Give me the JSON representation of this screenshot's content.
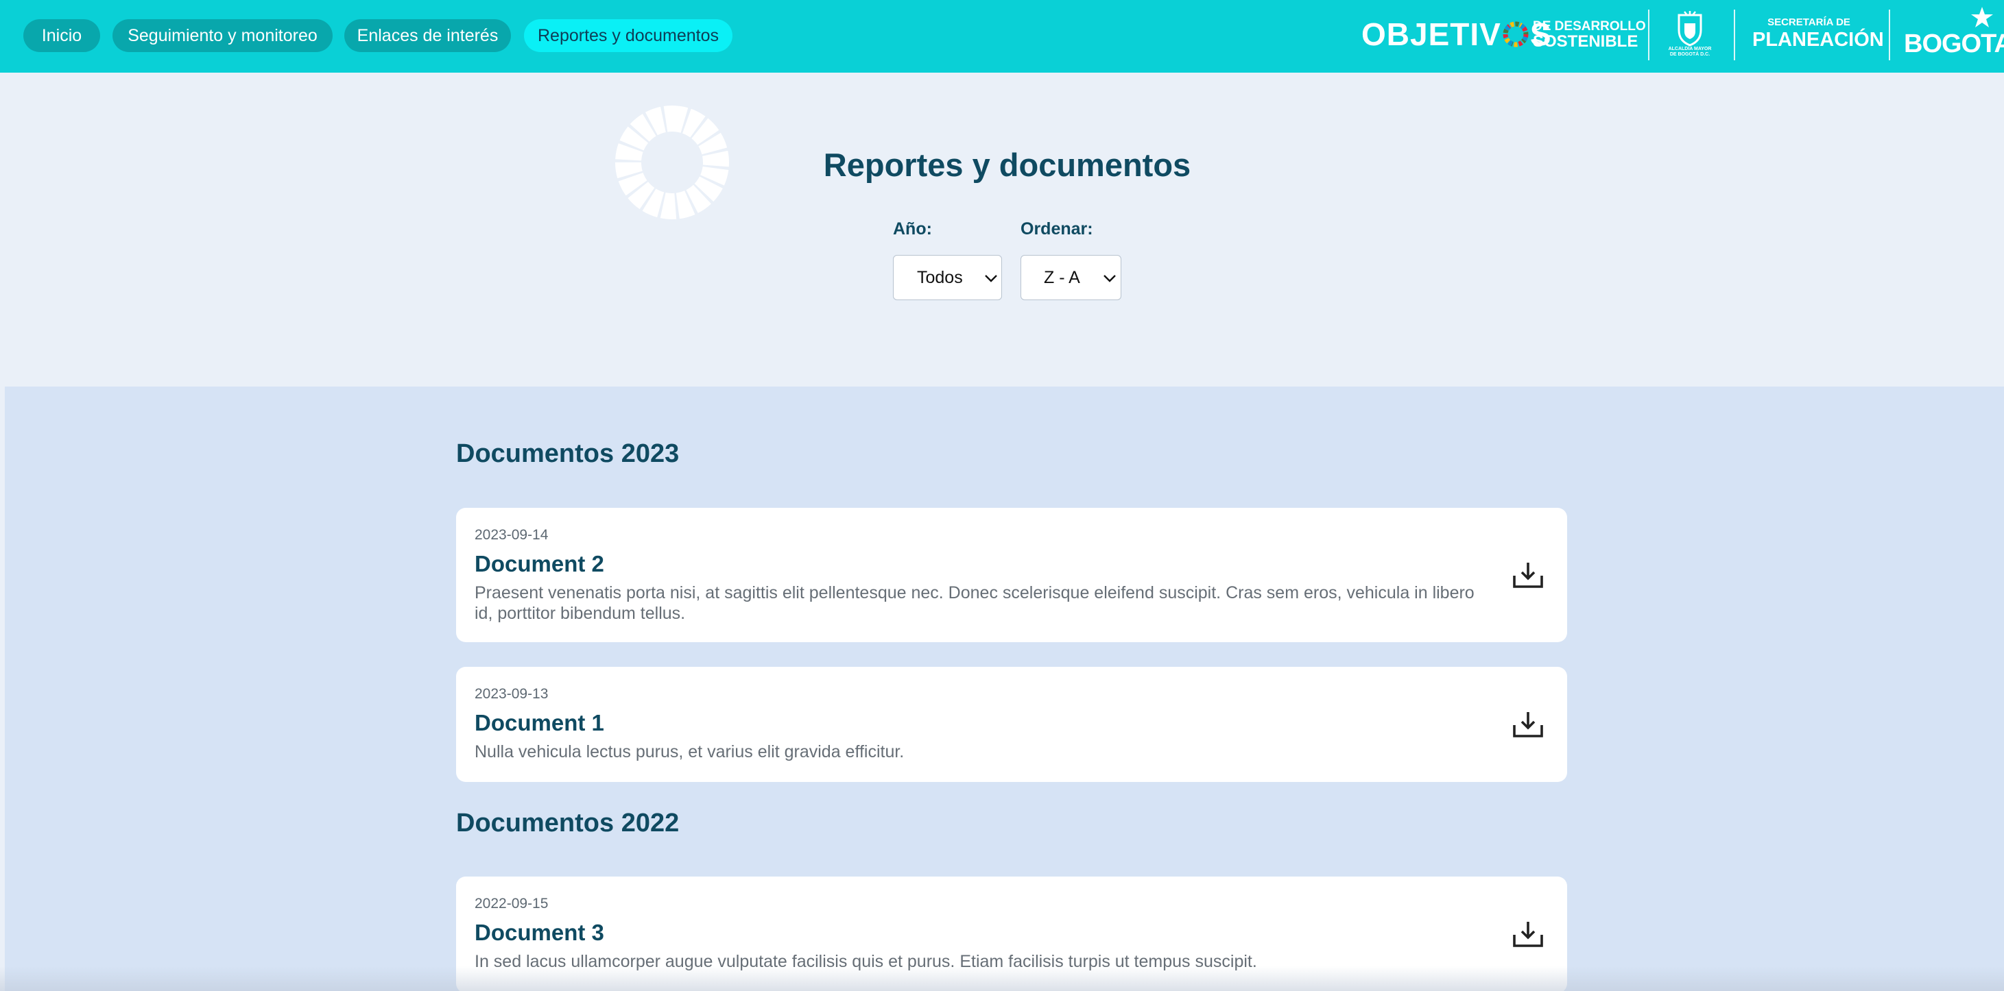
{
  "nav": {
    "items": [
      {
        "label": "Inicio"
      },
      {
        "label": "Seguimiento y monitoreo"
      },
      {
        "label": "Enlaces de interés"
      },
      {
        "label": "Reportes y documentos"
      }
    ],
    "active_index": 3
  },
  "logos": {
    "ods_big": "OBJETIV",
    "ods_big_end": "S",
    "ods_line1": "DE DESARROLLO",
    "ods_line2": "SOSTENIBLE",
    "alcaldia_caption": "ALCALDÍA MAYOR DE BOGOTÁ D.C.",
    "sdp_line1": "SECRETARÍA DE",
    "sdp_line2": "PLANEACIÓN",
    "bogota": "BOGOTA"
  },
  "header": {
    "title": "Reportes y documentos"
  },
  "filters": {
    "year_label": "Año:",
    "year_value": "Todos",
    "order_label": "Ordenar:",
    "order_value": "Z - A"
  },
  "sections": [
    {
      "title": "Documentos 2023",
      "documents": [
        {
          "date": "2023-09-14",
          "title": "Document 2",
          "description": "Praesent venenatis porta nisi, at sagittis elit pellentesque nec. Donec scelerisque eleifend suscipit. Cras sem eros, vehicula in libero id, porttitor bibendum tellus."
        },
        {
          "date": "2023-09-13",
          "title": "Document 1",
          "description": "Nulla vehicula lectus purus, et varius elit gravida efficitur."
        }
      ]
    },
    {
      "title": "Documentos 2022",
      "documents": [
        {
          "date": "2022-09-15",
          "title": "Document 3",
          "description": "In sed lacus ullamcorper augue vulputate facilisis quis et purus. Etiam facilisis turpis ut tempus suscipit."
        }
      ]
    }
  ],
  "colors": {
    "topbar": "#0ad0d6",
    "pill": "#08a7ac",
    "pill_active": "#0af0f6",
    "heading": "#0f4a61",
    "list_background": "#d6e3f5"
  }
}
